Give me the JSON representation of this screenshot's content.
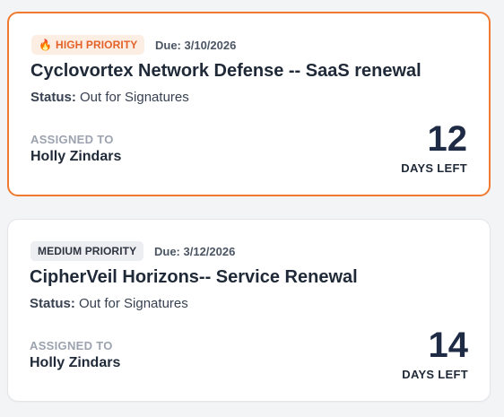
{
  "cards": [
    {
      "priority_icon": "fire-icon",
      "priority_icon_glyph": "🔥",
      "priority_label": "HIGH PRIORITY",
      "due": "Due: 3/10/2026",
      "title": "Cyclovortex Network Defense -- SaaS renewal",
      "status_key": "Status:",
      "status_value": "Out for Signatures",
      "assigned_label": "ASSIGNED TO",
      "assignee": "Holly Zindars",
      "days_left": "12",
      "days_label": "DAYS LEFT",
      "accent_color": "#f07a30"
    },
    {
      "priority_label": "MEDIUM PRIORITY",
      "due": "Due: 3/12/2026",
      "title": "CipherVeil Horizons-- Service Renewal",
      "status_key": "Status:",
      "status_value": "Out for Signatures",
      "assigned_label": "ASSIGNED TO",
      "assignee": "Holly Zindars",
      "days_left": "14",
      "days_label": "DAYS LEFT"
    }
  ]
}
